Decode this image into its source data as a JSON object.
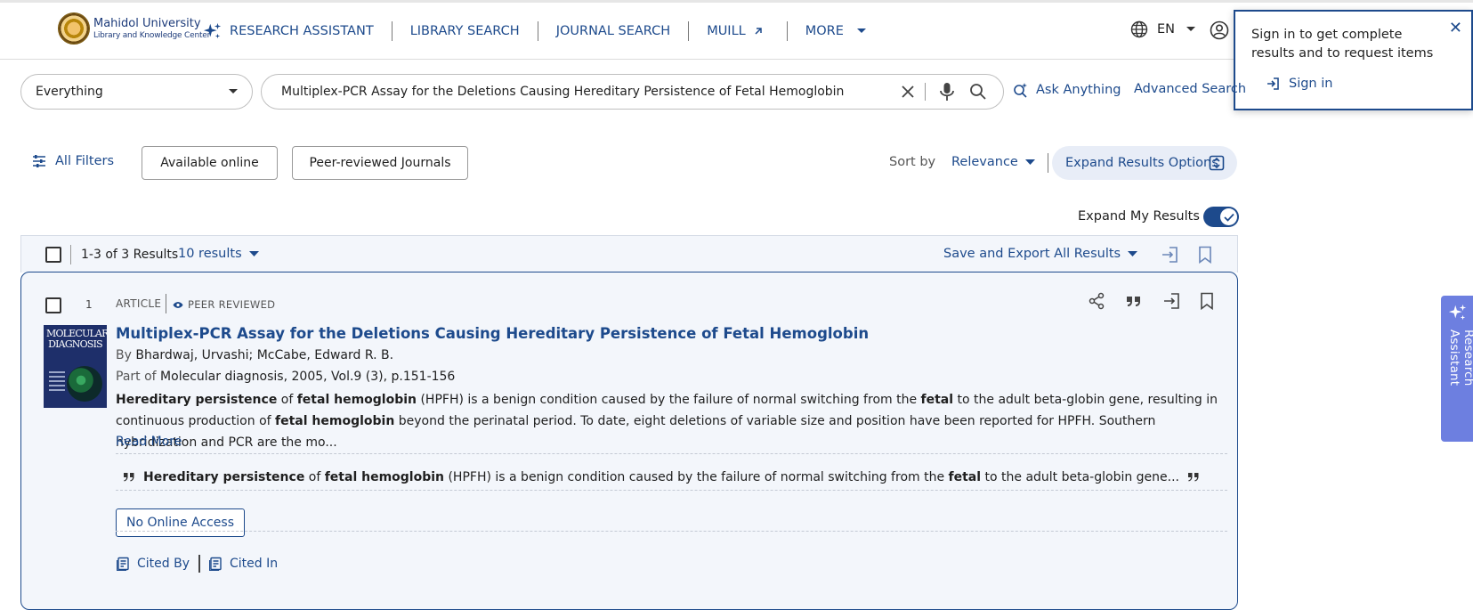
{
  "header": {
    "logo_line1": "Mahidol University",
    "logo_line2": "Library and Knowledge Center",
    "nav": [
      {
        "label": "RESEARCH ASSISTANT",
        "icon": "sparkle-icon"
      },
      {
        "label": "LIBRARY SEARCH"
      },
      {
        "label": "JOURNAL SEARCH"
      },
      {
        "label": "MUILL",
        "icon": "external-link-icon"
      },
      {
        "label": "MORE",
        "icon": "caret-down-icon"
      }
    ],
    "language": "EN"
  },
  "signin_popup": {
    "message": "Sign in to get complete results and to request items",
    "link": "Sign in"
  },
  "search": {
    "scope": "Everything",
    "query": "Multiplex-PCR Assay for the Deletions Causing Hereditary Persistence of Fetal Hemoglobin",
    "ask_anything": "Ask Anything",
    "advanced": "Advanced Search"
  },
  "filters": {
    "all_filters": "All Filters",
    "chips": [
      "Available online",
      "Peer-reviewed Journals"
    ],
    "sort_label": "Sort by",
    "sort_value": "Relevance",
    "expand_options": "Expand Results Options",
    "expand_my_results": "Expand My Results",
    "expand_my_results_on": true
  },
  "results_bar": {
    "count": "1-3 of 3 Results",
    "per_page": "10 results",
    "save_export": "Save and Export All Results"
  },
  "result": {
    "number": "1",
    "type": "ARTICLE",
    "peer": "PEER REVIEWED",
    "thumb_text": "MOLECULAR DIAGNOSIS",
    "title": "Multiplex-PCR Assay for the Deletions Causing Hereditary Persistence of Fetal Hemoglobin",
    "by_label": "By",
    "authors": "Bhardwaj, Urvashi; McCabe, Edward R. B.",
    "partof_label": "Part of",
    "source": "Molecular diagnosis, 2005, Vol.9 (3), p.151-156",
    "abstract": [
      {
        "b": true,
        "t": "Hereditary persistence"
      },
      {
        "b": false,
        "t": " of "
      },
      {
        "b": true,
        "t": "fetal hemoglobin"
      },
      {
        "b": false,
        "t": " (HPFH) is a benign condition caused by the failure of normal switching from the "
      },
      {
        "b": true,
        "t": "fetal"
      },
      {
        "b": false,
        "t": " to the adult beta-globin gene, resulting in continuous production of "
      },
      {
        "b": true,
        "t": "fetal hemoglobin"
      },
      {
        "b": false,
        "t": " beyond the perinatal period. To date, eight deletions of variable size and position have been reported for HPFH. Southern hybridization and PCR are the mo..."
      }
    ],
    "read_more": "Read More",
    "snippet": [
      {
        "b": true,
        "t": "Hereditary persistence"
      },
      {
        "b": false,
        "t": " of "
      },
      {
        "b": true,
        "t": "fetal hemoglobin"
      },
      {
        "b": false,
        "t": " (HPFH) is a benign condition caused by the failure of normal switching from the "
      },
      {
        "b": true,
        "t": "fetal"
      },
      {
        "b": false,
        "t": " to the adult beta-globin gene..."
      }
    ],
    "no_access": "No Online Access",
    "cited_by": "Cited By",
    "cited_in": "Cited In"
  },
  "side_tab": {
    "label": "Research Assistant"
  },
  "colors": {
    "primary": "#1d4a8c",
    "surface": "#f3f6fb",
    "assistant": "#6d7fe0"
  }
}
